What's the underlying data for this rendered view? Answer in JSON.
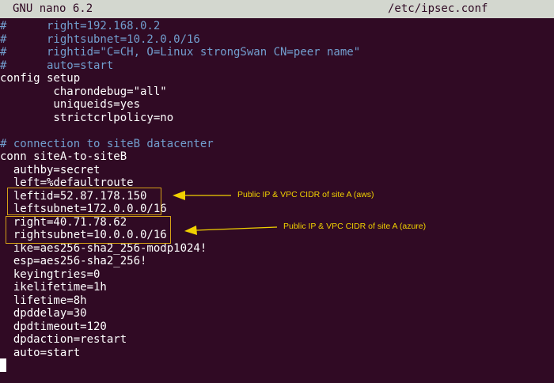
{
  "titlebar": {
    "program": "GNU nano 6.2",
    "filename": "/etc/ipsec.conf"
  },
  "editor": {
    "lines": [
      {
        "text": "#      right=192.168.0.2",
        "comment": true
      },
      {
        "text": "#      rightsubnet=10.2.0.0/16",
        "comment": true
      },
      {
        "text": "#      rightid=\"C=CH, O=Linux strongSwan CN=peer name\"",
        "comment": true
      },
      {
        "text": "#      auto=start",
        "comment": true
      },
      {
        "text": "config setup",
        "comment": false
      },
      {
        "text": "        charondebug=\"all\"",
        "comment": false
      },
      {
        "text": "        uniqueids=yes",
        "comment": false
      },
      {
        "text": "        strictcrlpolicy=no",
        "comment": false
      },
      {
        "text": "",
        "comment": false
      },
      {
        "text": "# connection to siteB datacenter",
        "comment": true
      },
      {
        "text": "conn siteA-to-siteB",
        "comment": false
      },
      {
        "text": "  authby=secret",
        "comment": false
      },
      {
        "text": "  left=%defaultroute",
        "comment": false
      },
      {
        "text": "  leftid=52.87.178.150",
        "comment": false
      },
      {
        "text": "  leftsubnet=172.0.0.0/16",
        "comment": false
      },
      {
        "text": "  right=40.71.78.62",
        "comment": false
      },
      {
        "text": "  rightsubnet=10.0.0.0/16",
        "comment": false
      },
      {
        "text": "  ike=aes256-sha2_256-modp1024!",
        "comment": false
      },
      {
        "text": "  esp=aes256-sha2_256!",
        "comment": false
      },
      {
        "text": "  keyingtries=0",
        "comment": false
      },
      {
        "text": "  ikelifetime=1h",
        "comment": false
      },
      {
        "text": "  lifetime=8h",
        "comment": false
      },
      {
        "text": "  dpddelay=30",
        "comment": false
      },
      {
        "text": "  dpdtimeout=120",
        "comment": false
      },
      {
        "text": "  dpdaction=restart",
        "comment": false
      },
      {
        "text": "  auto=start",
        "comment": false
      }
    ]
  },
  "annotations": {
    "aws_note": "Public IP & VPC CIDR of site A (aws)",
    "azure_note": "Public IP & VPC CIDR of site A (azure)",
    "color": "#f0d000"
  },
  "colors": {
    "background": "#300a24",
    "titlebar": "#d3d7cf",
    "comment": "#729fcf",
    "text": "#ffffff"
  }
}
